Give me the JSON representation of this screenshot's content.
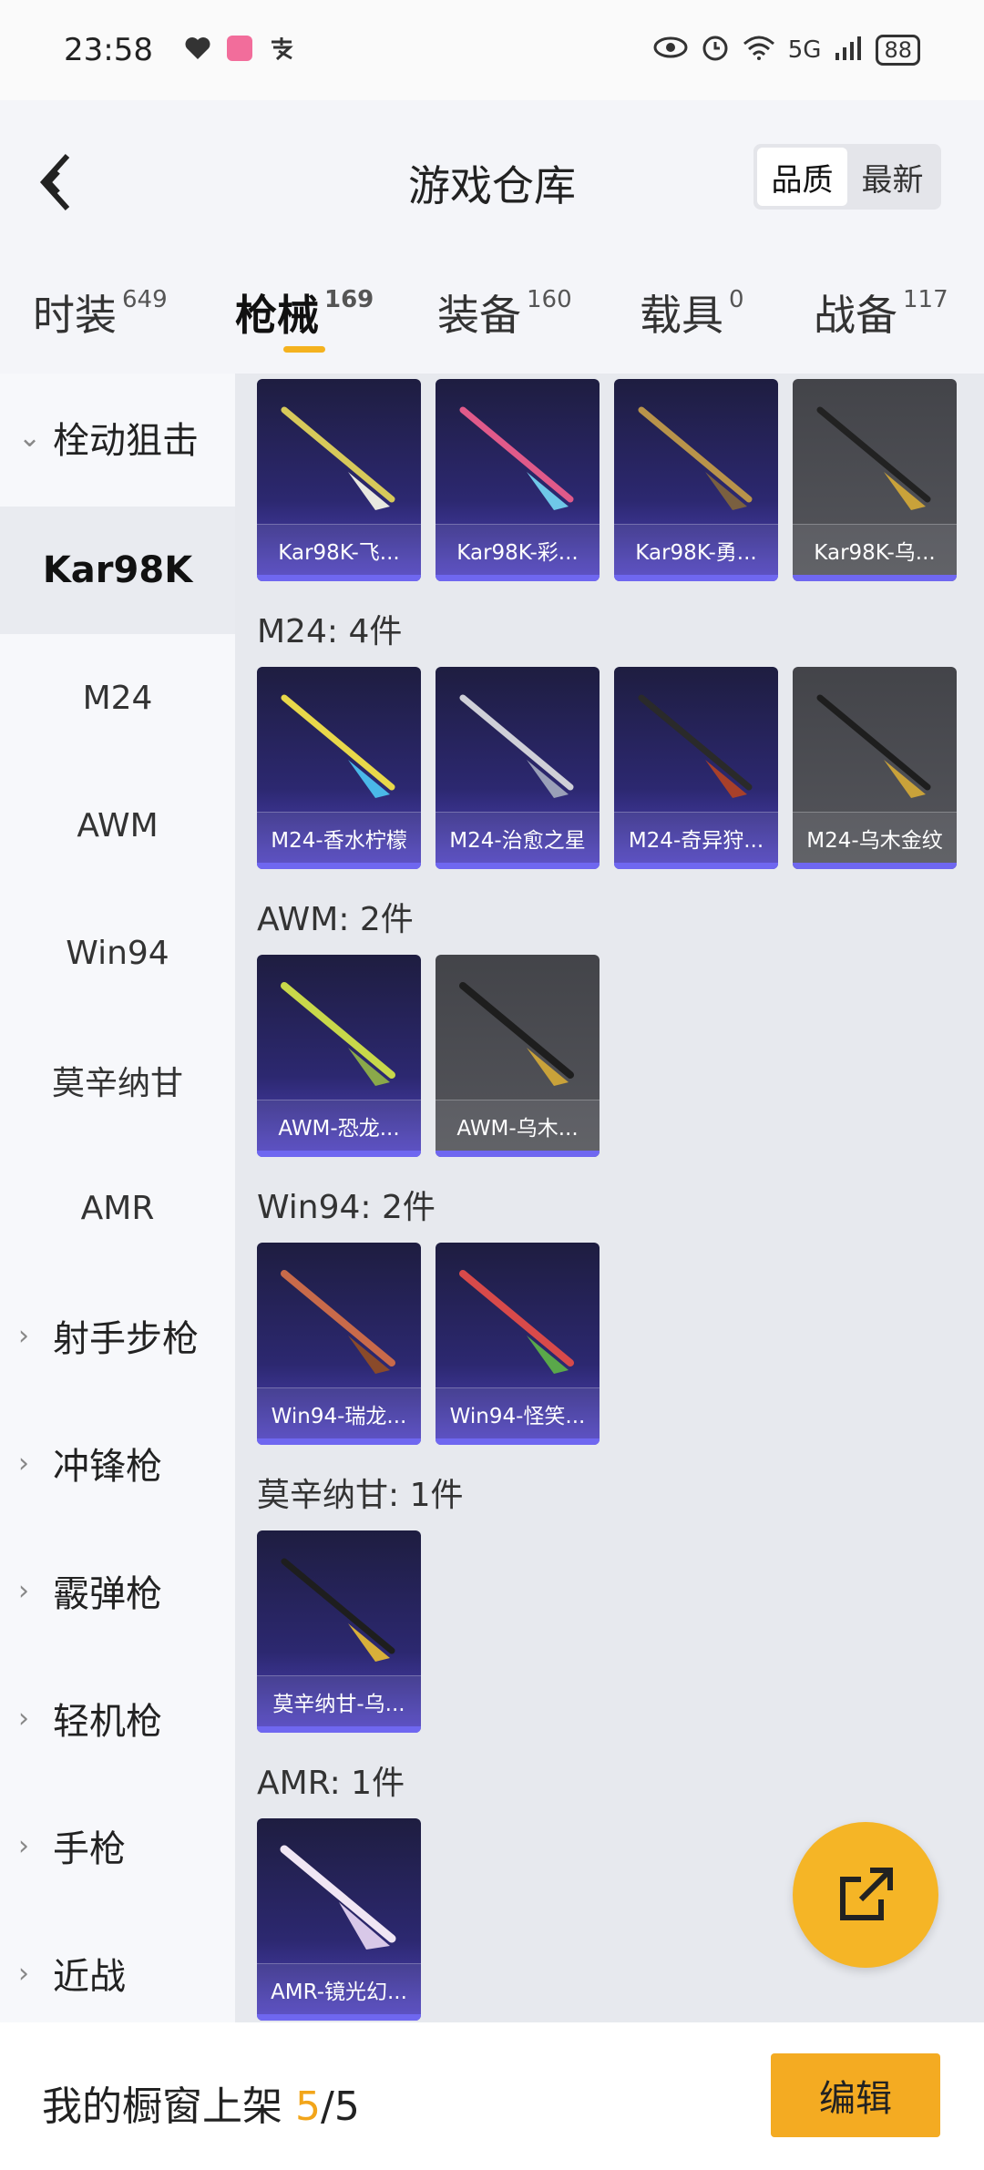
{
  "status_bar": {
    "time": "23:58",
    "battery": "88",
    "network": "5G"
  },
  "header": {
    "title": "游戏仓库",
    "sort_quality": "品质",
    "sort_latest": "最新"
  },
  "tabs": [
    {
      "label": "时装",
      "count": "649"
    },
    {
      "label": "枪械",
      "count": "169"
    },
    {
      "label": "装备",
      "count": "160"
    },
    {
      "label": "载具",
      "count": "0"
    },
    {
      "label": "战备",
      "count": "117"
    }
  ],
  "sidebar": {
    "group_open": "栓动狙击",
    "subitems": [
      "Kar98K",
      "M24",
      "AWM",
      "Win94",
      "莫辛纳甘",
      "AMR"
    ],
    "groups": [
      "射手步枪",
      "冲锋枪",
      "霰弹枪",
      "轻机枪",
      "手枪",
      "近战"
    ]
  },
  "sections": {
    "m24": "M24: 4件",
    "awm": "AWM: 2件",
    "win94": "Win94: 2件",
    "mosin": "莫辛纳甘: 1件",
    "amr": "AMR: 1件"
  },
  "cards": {
    "kar98k": [
      "Kar98K-飞...",
      "Kar98K-彩...",
      "Kar98K-勇...",
      "Kar98K-乌..."
    ],
    "m24": [
      "M24-香水柠檬",
      "M24-治愈之星",
      "M24-奇异狩...",
      "M24-乌木金纹"
    ],
    "awm": [
      "AWM-恐龙...",
      "AWM-乌木..."
    ],
    "win94": [
      "Win94-瑞龙...",
      "Win94-怪笑..."
    ],
    "mosin": [
      "莫辛纳甘-乌..."
    ],
    "amr": [
      "AMR-镜光幻..."
    ]
  },
  "footer": {
    "showcase_label": "我的橱窗上架 ",
    "count_current": "5",
    "count_total": "/5",
    "edit_label": "编辑"
  },
  "colors": {
    "accent": "#f4ab22",
    "card_purple": "#5346c4",
    "card_gray": "#55565c"
  }
}
